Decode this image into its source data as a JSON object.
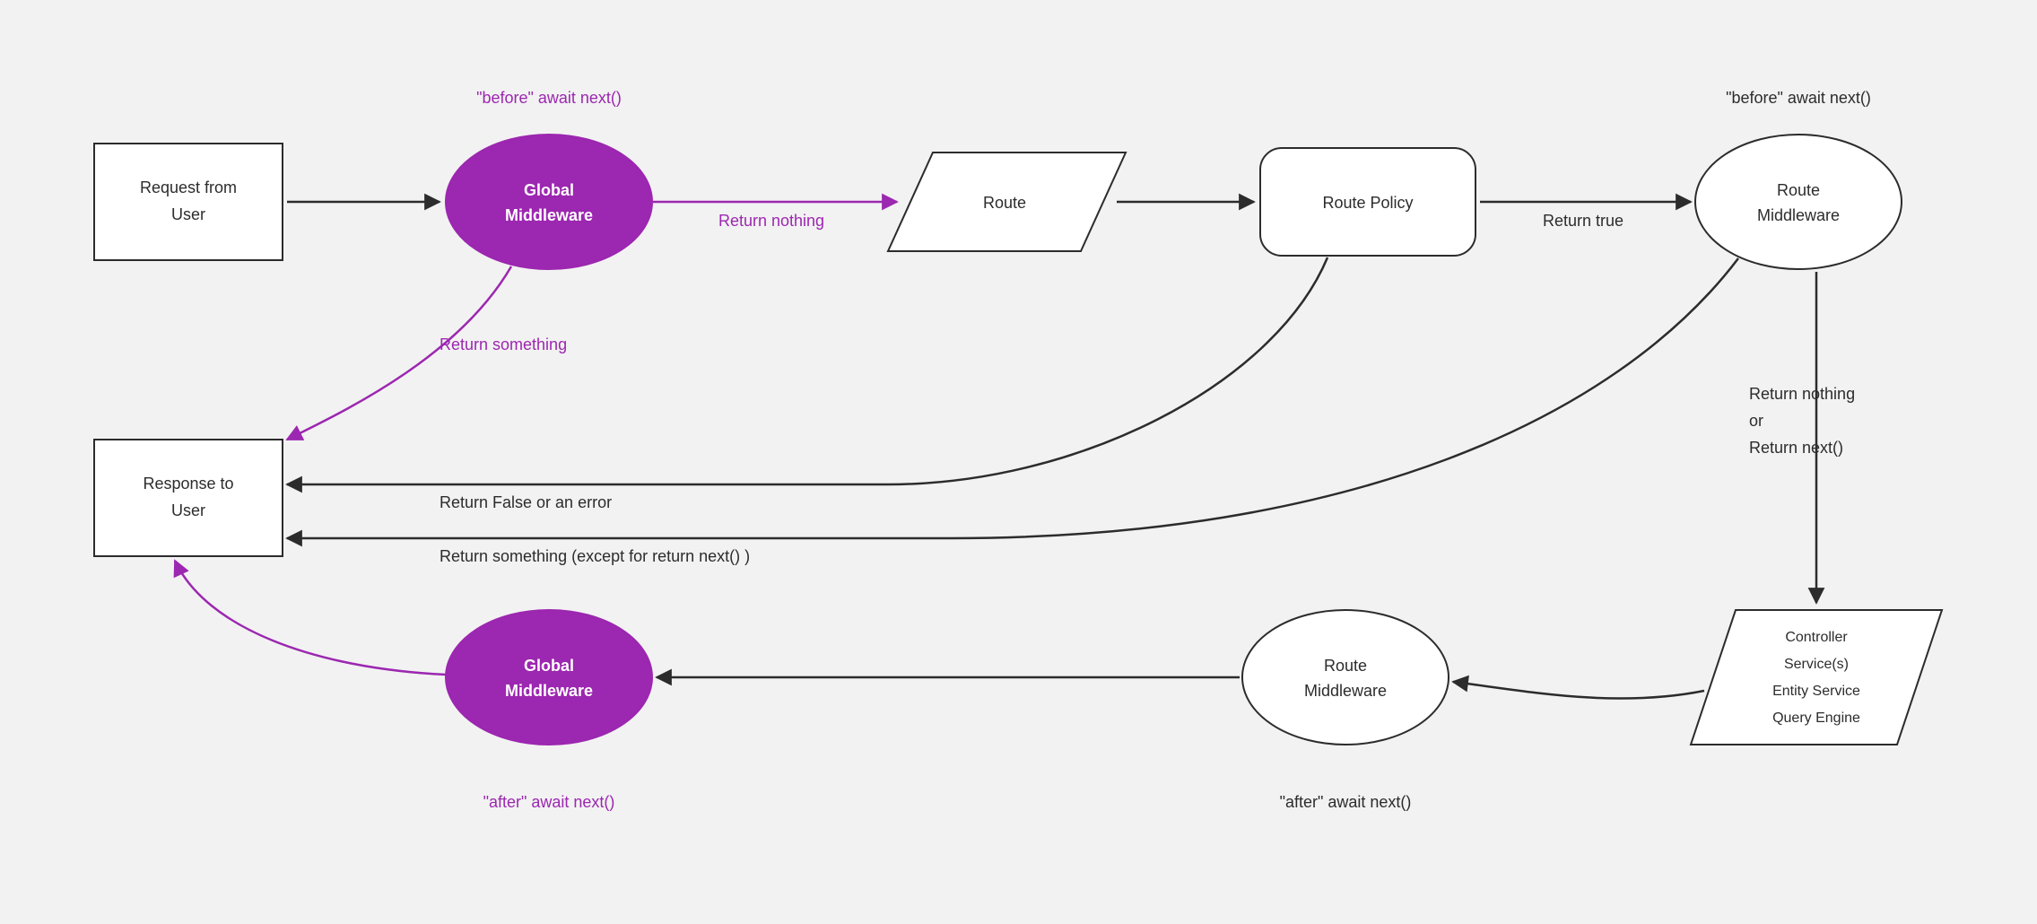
{
  "diagram": {
    "nodes": {
      "request": {
        "line1": "Request from",
        "line2": "User"
      },
      "globalMW1": {
        "line1": "Global",
        "line2": "Middleware",
        "caption_above": "\"before\" await next()"
      },
      "route": {
        "label": "Route"
      },
      "policy": {
        "label": "Route Policy"
      },
      "routeMW1": {
        "line1": "Route",
        "line2": "Middleware",
        "caption_above": "\"before\" await next()"
      },
      "layers": {
        "line1": "Controller",
        "line2": "Service(s)",
        "line3": "Entity Service",
        "line4": "Query Engine"
      },
      "routeMW2": {
        "line1": "Route",
        "line2": "Middleware",
        "caption_below": "\"after\" await next()"
      },
      "globalMW2": {
        "line1": "Global",
        "line2": "Middleware",
        "caption_below": "\"after\" await next()"
      },
      "response": {
        "line1": "Response to",
        "line2": "User"
      }
    },
    "edges": {
      "gmw_to_route": "Return nothing",
      "gmw_to_response": "Return something",
      "policy_to_routeMW": "Return true",
      "policy_to_response": "Return False or an error",
      "routeMW_to_response": "Return something (except for return next() )",
      "routeMW_to_layers_1": "Return nothing",
      "routeMW_to_layers_2": "or",
      "routeMW_to_layers_3": "Return next()"
    },
    "colors": {
      "purple": "#9c27b0",
      "stroke": "#2c2c2c",
      "bg": "#f2f2f2"
    }
  }
}
